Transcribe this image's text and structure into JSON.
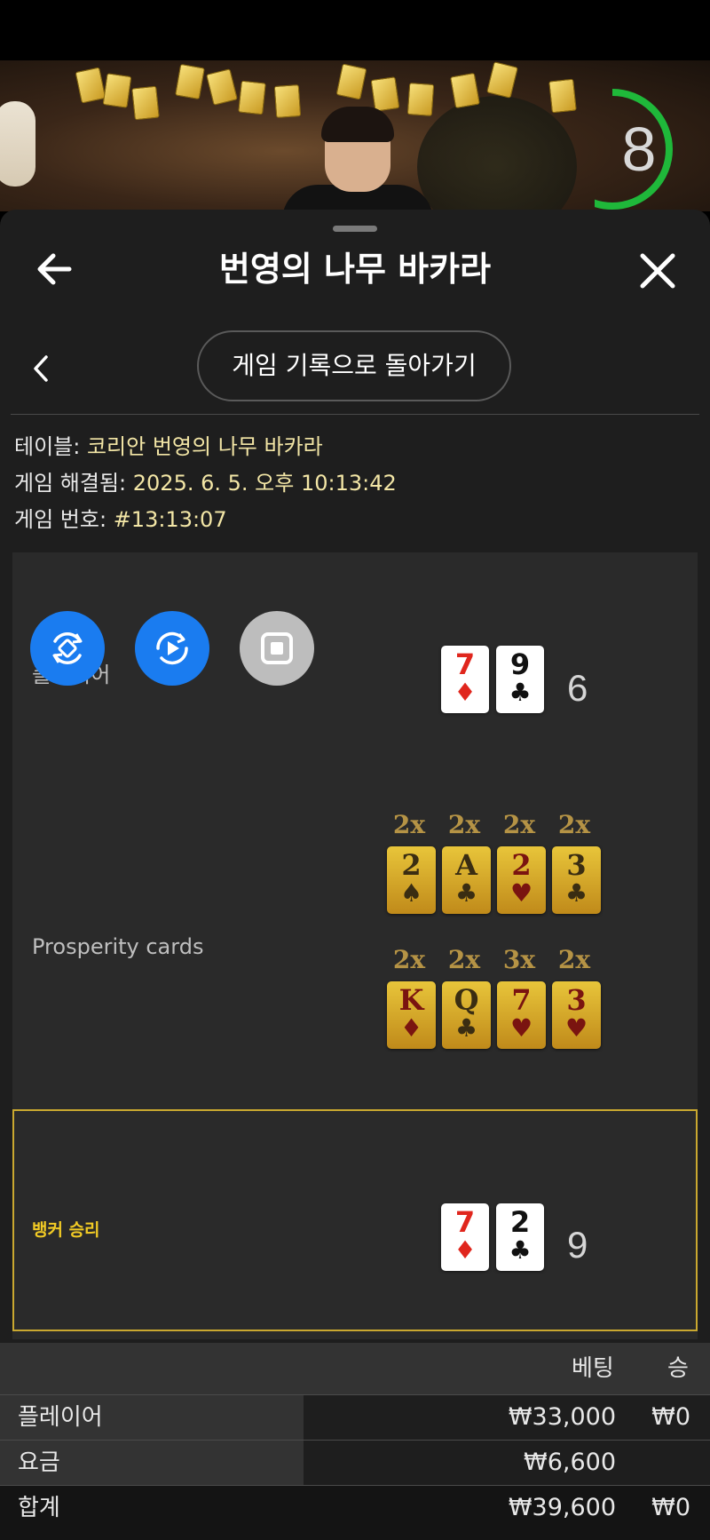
{
  "timer": {
    "value": "8",
    "progress": 0.6
  },
  "header": {
    "title": "번영의 나무 바카라"
  },
  "nav": {
    "back_to_history_label": "게임 기록으로 돌아가기"
  },
  "info": {
    "table_label": "테이블:",
    "table_value": "코리안 번영의 나무 바카라",
    "resolved_label": "게임 해결됨:",
    "resolved_value": "2025. 6. 5. 오후 10:13:42",
    "game_no_label": "게임 번호:",
    "game_no_value": "#13:13:07"
  },
  "player": {
    "label": "플레이어",
    "cards": [
      {
        "rank": "7",
        "suit": "♦",
        "color": "red"
      },
      {
        "rank": "9",
        "suit": "♣",
        "color": "black"
      }
    ],
    "score": "6"
  },
  "prosperity": {
    "label": "Prosperity cards",
    "row1": [
      {
        "mult": "2x",
        "rank": "2",
        "suit": "♠",
        "color": "dark"
      },
      {
        "mult": "2x",
        "rank": "A",
        "suit": "♣",
        "color": "dark"
      },
      {
        "mult": "2x",
        "rank": "2",
        "suit": "♥",
        "color": "red"
      },
      {
        "mult": "2x",
        "rank": "3",
        "suit": "♣",
        "color": "dark"
      }
    ],
    "row2": [
      {
        "mult": "2x",
        "rank": "K",
        "suit": "♦",
        "color": "red"
      },
      {
        "mult": "2x",
        "rank": "Q",
        "suit": "♣",
        "color": "dark"
      },
      {
        "mult": "3x",
        "rank": "7",
        "suit": "♥",
        "color": "red"
      },
      {
        "mult": "2x",
        "rank": "3",
        "suit": "♥",
        "color": "red"
      }
    ]
  },
  "banker": {
    "label": "뱅커 승리",
    "cards": [
      {
        "rank": "7",
        "suit": "♦",
        "color": "red"
      },
      {
        "rank": "2",
        "suit": "♣",
        "color": "black"
      }
    ],
    "score": "9"
  },
  "bet_table": {
    "col_bet": "베팅",
    "col_win": "승",
    "rows": [
      {
        "label": "플레이어",
        "bet": "₩33,000",
        "win": "₩0"
      },
      {
        "label": "요금",
        "bet": "₩6,600",
        "win": ""
      }
    ],
    "total": {
      "label": "합계",
      "bet": "₩39,600",
      "win": "₩0"
    }
  },
  "colors": {
    "accent_gold": "#f2cb25",
    "fab_blue": "#1a7cf0",
    "fab_gray": "#bdbdbd",
    "timer_green": "#1fb83a"
  }
}
